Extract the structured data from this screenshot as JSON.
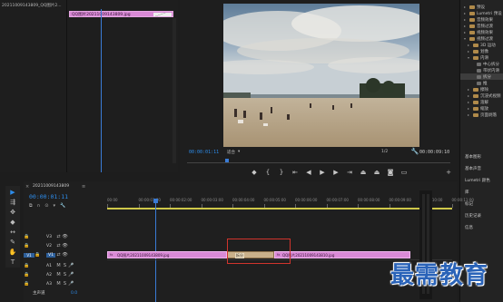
{
  "source_panel": {
    "tab_label": "20211009143809_QQ图片2...",
    "clip_name": "QQ图片20211009143809.jpg"
  },
  "program_monitor": {
    "timecode_left": "00:00:01:11",
    "fit_label": "适合",
    "resolution": "1/2",
    "timecode_right": "00:00:09:10"
  },
  "effects_panel": {
    "tree": [
      {
        "label": "预设",
        "indent": 1,
        "expanded": false
      },
      {
        "label": "Lumetri 预设",
        "indent": 1,
        "expanded": false
      },
      {
        "label": "音频效果",
        "indent": 1,
        "expanded": false
      },
      {
        "label": "音频过渡",
        "indent": 1,
        "expanded": false
      },
      {
        "label": "视频效果",
        "indent": 1,
        "expanded": false
      },
      {
        "label": "视频过渡",
        "indent": 1,
        "expanded": true
      },
      {
        "label": "3D 运动",
        "indent": 2,
        "expanded": false
      },
      {
        "label": "划像",
        "indent": 2,
        "expanded": false
      },
      {
        "label": "内滑",
        "indent": 2,
        "expanded": true
      },
      {
        "label": "中心拆分",
        "indent": 3,
        "expanded": false
      },
      {
        "label": "带状内滑",
        "indent": 3,
        "expanded": false
      },
      {
        "label": "拆分",
        "indent": 3,
        "expanded": false,
        "selected": true
      },
      {
        "label": "推",
        "indent": 3,
        "expanded": false
      },
      {
        "label": "擦除",
        "indent": 2,
        "expanded": false
      },
      {
        "label": "沉浸式视频",
        "indent": 2,
        "expanded": false
      },
      {
        "label": "溶解",
        "indent": 2,
        "expanded": false
      },
      {
        "label": "缩放",
        "indent": 2,
        "expanded": false
      },
      {
        "label": "页面剥落",
        "indent": 2,
        "expanded": false
      }
    ],
    "panel_links": [
      "基本图形",
      "基本声音",
      "Lumetri 颜色",
      "库",
      "标记",
      "历史记录",
      "信息"
    ]
  },
  "timeline": {
    "sequence_tab": "20211009143809",
    "timecode": "00:00:01:11",
    "ruler_labels": [
      "00:00",
      "00:00:01:00",
      "00:00:02:00",
      "00:00:03:00",
      "00:00:04:00",
      "00:00:05:00",
      "00:00:06:00",
      "00:00:07:00",
      "00:00:08:00",
      "00:00:09:00",
      "00:00:10:00",
      "00:00:11:00"
    ],
    "video_tracks": [
      "V3",
      "V2",
      "V1"
    ],
    "audio_tracks": [
      "A1",
      "A2",
      "A3"
    ],
    "master_label": "主声道",
    "master_value": "0.0",
    "clip1": "QQ图片20211009143809.jpg",
    "transition_label": "拆分",
    "clip2": "QQ图片20211009143810.jpg",
    "v1_label": "V1"
  },
  "watermark": "最需教育"
}
